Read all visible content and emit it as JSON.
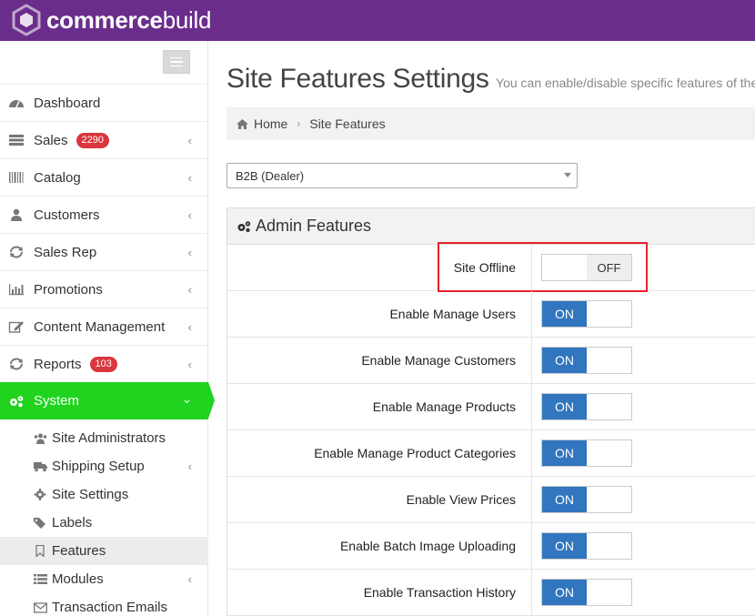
{
  "brand": {
    "name_bold": "commerce",
    "name_light": "build",
    "color": "#6b2d8b"
  },
  "sidebar": {
    "items": [
      {
        "label": "Dashboard",
        "icon": "dashboard-icon"
      },
      {
        "label": "Sales",
        "badge": "2290",
        "icon": "sales-icon"
      },
      {
        "label": "Catalog",
        "icon": "barcode-icon"
      },
      {
        "label": "Customers",
        "icon": "user-icon"
      },
      {
        "label": "Sales Rep",
        "icon": "refresh-icon"
      },
      {
        "label": "Promotions",
        "icon": "bar-chart-icon"
      },
      {
        "label": "Content Management",
        "icon": "edit-icon"
      },
      {
        "label": "Reports",
        "badge": "103",
        "icon": "refresh-icon"
      },
      {
        "label": "System",
        "icon": "gears-icon",
        "active": true
      }
    ],
    "subitems": [
      {
        "label": "Site Administrators",
        "icon": "users-icon"
      },
      {
        "label": "Shipping Setup",
        "icon": "truck-icon"
      },
      {
        "label": "Site Settings",
        "icon": "gear-icon"
      },
      {
        "label": "Labels",
        "icon": "tags-icon"
      },
      {
        "label": "Features",
        "icon": "bookmark-icon",
        "active": true
      },
      {
        "label": "Modules",
        "icon": "list-icon"
      },
      {
        "label": "Transaction Emails",
        "icon": "envelope-icon"
      }
    ]
  },
  "main": {
    "title": "Site Features Settings",
    "subtitle": "You can enable/disable specific features of the site",
    "breadcrumb": {
      "home": "Home",
      "current": "Site Features"
    },
    "site_select": {
      "value": "B2B (Dealer)"
    },
    "panel": {
      "title": "Admin Features",
      "rows": [
        {
          "label": "Site Offline",
          "state": "OFF"
        },
        {
          "label": "Enable Manage Users",
          "state": "ON"
        },
        {
          "label": "Enable Manage Customers",
          "state": "ON"
        },
        {
          "label": "Enable Manage Products",
          "state": "ON"
        },
        {
          "label": "Enable Manage Product Categories",
          "state": "ON"
        },
        {
          "label": "Enable View Prices",
          "state": "ON"
        },
        {
          "label": "Enable Batch Image Uploading",
          "state": "ON"
        },
        {
          "label": "Enable Transaction History",
          "state": "ON"
        }
      ]
    }
  },
  "colors": {
    "active_nav": "#1fd31f",
    "toggle_on": "#3176bf",
    "badge": "#d9363e",
    "highlight": "#e8202a"
  }
}
